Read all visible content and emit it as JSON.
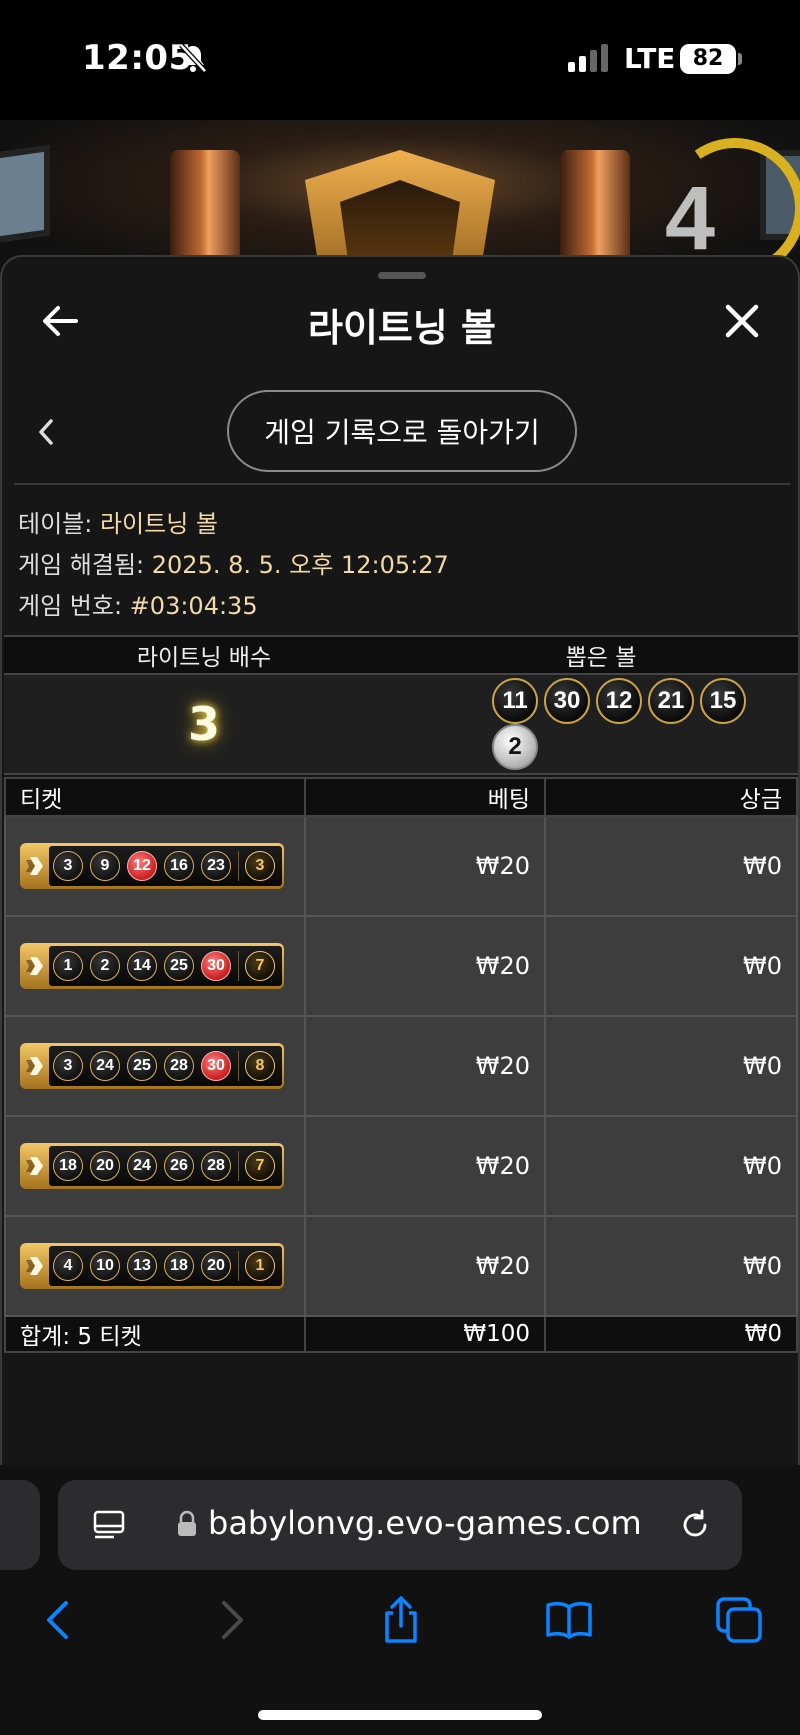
{
  "status_bar": {
    "time": "12:05",
    "network": "LTE",
    "battery": "82"
  },
  "game": {
    "countdown": "4"
  },
  "sheet": {
    "title": "라이트닝 볼",
    "back_to_history": "게임 기록으로 돌아가기"
  },
  "info": {
    "table_label": "테이블:",
    "table_value": "라이트닝 볼",
    "resolved_label": "게임 해결됨:",
    "resolved_value": "2025. 8. 5. 오후 12:05:27",
    "number_label": "게임 번호:",
    "number_value": "#03:04:35"
  },
  "draw": {
    "multiplier_header": "라이트닝 배수",
    "balls_header": "뽑은 볼",
    "multiplier": "3",
    "balls": [
      "11",
      "30",
      "12",
      "21",
      "15",
      "2"
    ]
  },
  "tickets": {
    "headers": {
      "ticket": "티켓",
      "bet": "베팅",
      "win": "상금"
    },
    "rows": [
      {
        "balls": [
          "3",
          "9",
          "12",
          "16",
          "23"
        ],
        "hits": [
          false,
          false,
          true,
          false,
          false
        ],
        "lightning": "3",
        "bet": "₩20",
        "win": "₩0"
      },
      {
        "balls": [
          "1",
          "2",
          "14",
          "25",
          "30"
        ],
        "hits": [
          false,
          false,
          false,
          false,
          true
        ],
        "lightning": "7",
        "bet": "₩20",
        "win": "₩0"
      },
      {
        "balls": [
          "3",
          "24",
          "25",
          "28",
          "30"
        ],
        "hits": [
          false,
          false,
          false,
          false,
          true
        ],
        "lightning": "8",
        "bet": "₩20",
        "win": "₩0"
      },
      {
        "balls": [
          "18",
          "20",
          "24",
          "26",
          "28"
        ],
        "hits": [
          false,
          false,
          false,
          false,
          false
        ],
        "lightning": "7",
        "bet": "₩20",
        "win": "₩0"
      },
      {
        "balls": [
          "4",
          "10",
          "13",
          "18",
          "20"
        ],
        "hits": [
          false,
          false,
          false,
          false,
          false
        ],
        "lightning": "1",
        "bet": "₩20",
        "win": "₩0"
      }
    ],
    "total": {
      "label": "합계: 5 티켓",
      "bet": "₩100",
      "win": "₩0"
    }
  },
  "browser": {
    "url": "babylonvg.evo-games.com",
    "accent": "#0a84ff"
  },
  "icons": {
    "bell": "bell-slash-icon",
    "back": "arrow-left-icon",
    "close": "close-icon",
    "chevron": "chevron-left-icon",
    "tabs": "reader-icon",
    "lock": "lock-icon",
    "reload": "reload-icon",
    "share": "share-icon",
    "bookmarks": "book-icon",
    "pages": "tabs-icon"
  }
}
